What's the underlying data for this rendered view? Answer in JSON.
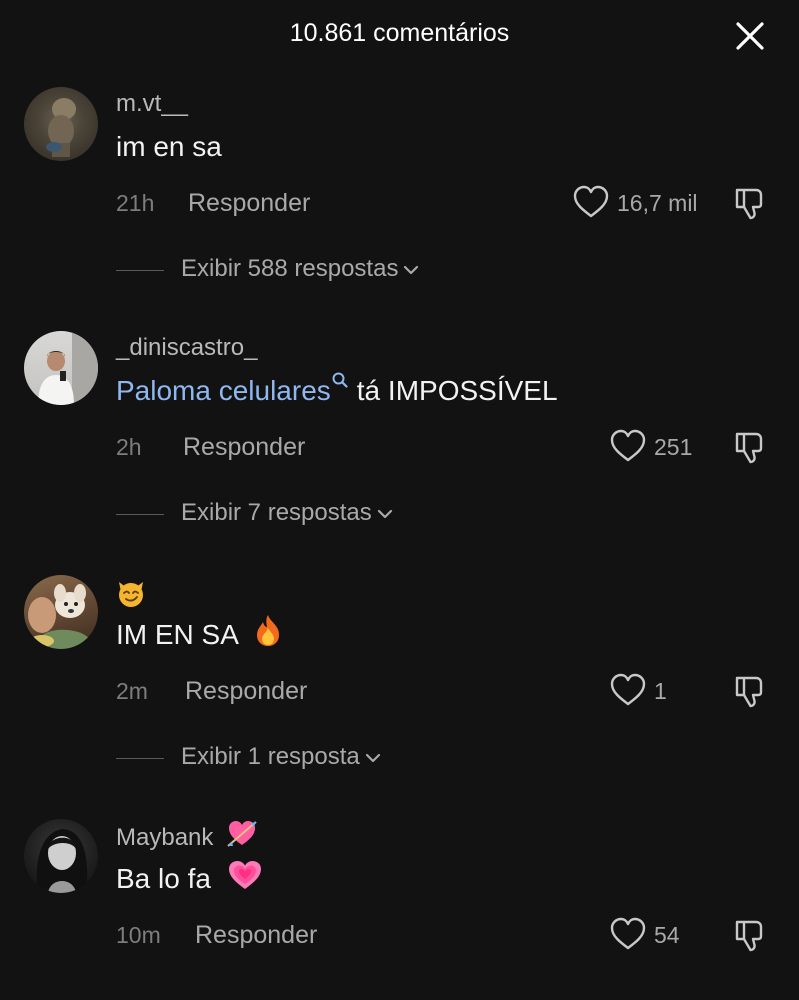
{
  "header": {
    "title": "10.861 comentários"
  },
  "comments": [
    {
      "username": "m.vt__",
      "text": "im en sa",
      "time": "21h",
      "reply_label": "Responder",
      "likes": "16,7 mil",
      "replies_label": "Exibir 588 respostas"
    },
    {
      "username": "_diniscastro_",
      "mention": "Paloma celulares",
      "text": "tá IMPOSSÍVEL",
      "time": "2h",
      "reply_label": "Responder",
      "likes": "251",
      "replies_label": "Exibir 7 respostas"
    },
    {
      "username": "😼",
      "text": "IM EN SA",
      "text_emoji": "🔥",
      "time": "2m",
      "reply_label": "Responder",
      "likes": "1",
      "replies_label": "Exibir 1 resposta"
    },
    {
      "username": "Maybank",
      "username_emoji": "💘",
      "text": "Ba lo fa",
      "text_emoji": "💗",
      "time": "10m",
      "reply_label": "Responder",
      "likes": "54"
    }
  ],
  "icons": {
    "close": "close-icon",
    "like": "heart-outline-icon",
    "dislike": "thumbs-down-icon",
    "mention": "search-icon",
    "expand": "chevron-down-icon"
  },
  "colors": {
    "background": "#121212",
    "mention": "#8fb7f0",
    "secondary_text": "#a9a9a9"
  }
}
